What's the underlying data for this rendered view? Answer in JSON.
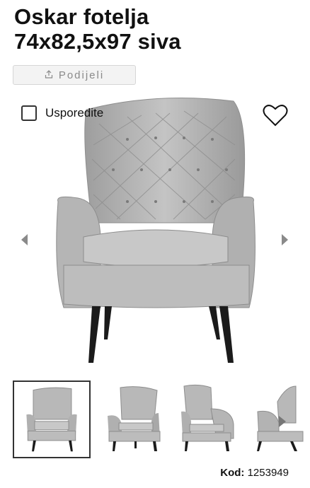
{
  "product": {
    "title_line1": "Oskar fotelja",
    "title_line2": "74x82,5x97 siva",
    "share_label": "Podijeli",
    "compare_label": "Usporedite",
    "code_label": "Kod:",
    "code_value": "1253949"
  },
  "gallery": {
    "main_image_alt": "siva fotelja",
    "thumbnails": [
      "front",
      "angle",
      "side-angle",
      "side"
    ]
  },
  "icons": [
    "share-icon",
    "heart-icon",
    "chevron-left-icon",
    "chevron-right-icon"
  ],
  "colors": {
    "chair_fabric": "#b9b9b9",
    "chair_shadow": "#8f8f8f",
    "legs": "#1b1b1b",
    "button_bg": "#f3f3f3"
  }
}
